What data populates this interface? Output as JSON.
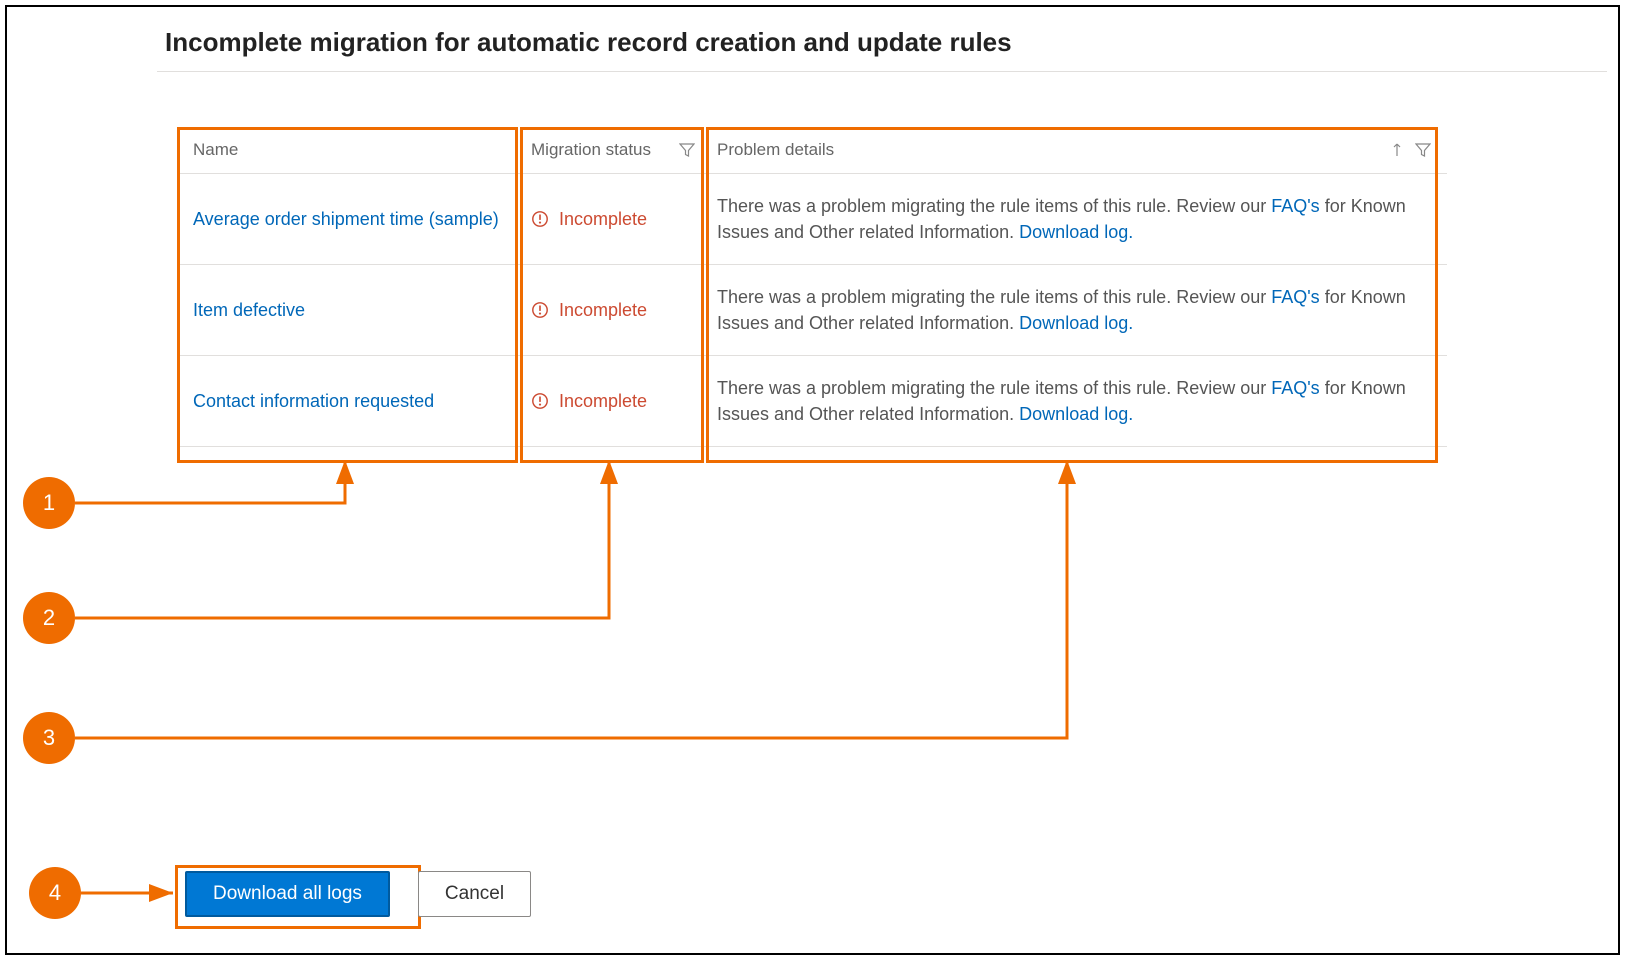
{
  "header": {
    "title": "Incomplete migration for automatic record creation and update rules"
  },
  "columns": {
    "name": "Name",
    "status": "Migration status",
    "details": "Problem details"
  },
  "statusText": "Incomplete",
  "problem": {
    "prefix": "There was a problem migrating the rule items of this rule. Review our ",
    "faq": "FAQ's",
    "middle": " for Known Issues and Other related Information. ",
    "download": "Download log."
  },
  "rows": [
    {
      "name": "Average order shipment time (sample)"
    },
    {
      "name": "Item defective"
    },
    {
      "name": "Contact information requested"
    }
  ],
  "buttons": {
    "primary": "Download all logs",
    "secondary": "Cancel"
  },
  "callouts": {
    "c1": "1",
    "c2": "2",
    "c3": "3",
    "c4": "4"
  }
}
